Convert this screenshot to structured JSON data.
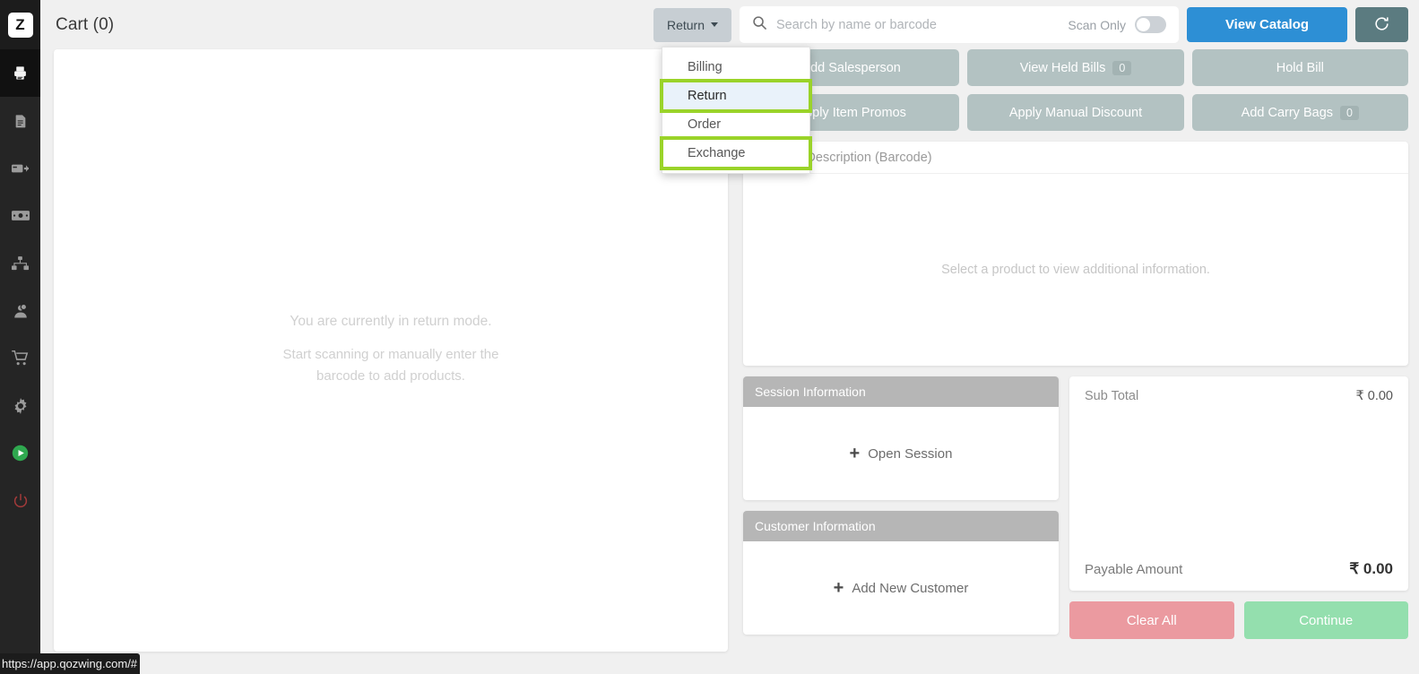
{
  "sidebar": {
    "logo_text": "Z",
    "items": [
      {
        "name": "receipt-printer",
        "label": "Billing",
        "active": true
      },
      {
        "name": "document",
        "label": "Documents",
        "active": false
      },
      {
        "name": "card-swipe",
        "label": "Payments",
        "active": false
      },
      {
        "name": "cash-note",
        "label": "Cash",
        "active": false
      },
      {
        "name": "org-chart",
        "label": "Hierarchy",
        "active": false
      },
      {
        "name": "user-profile",
        "label": "Customers",
        "active": false
      },
      {
        "name": "shopping-cart",
        "label": "Cart",
        "active": false
      },
      {
        "name": "gear",
        "label": "Settings",
        "active": false
      },
      {
        "name": "play-circle",
        "label": "Start",
        "active": false
      },
      {
        "name": "power",
        "label": "Logout",
        "active": false
      }
    ]
  },
  "header": {
    "cart_title": "Cart (0)",
    "mode_button": "Return",
    "search_placeholder": "Search by name or barcode",
    "search_value": "",
    "scan_only_label": "Scan Only",
    "scan_only_on": false,
    "view_catalog": "View Catalog",
    "refresh_icon": "refresh-icon"
  },
  "dropdown": {
    "open": true,
    "items": [
      {
        "label": "Billing",
        "selected": false,
        "highlighted": false
      },
      {
        "label": "Return",
        "selected": true,
        "highlighted": true
      },
      {
        "label": "Order",
        "selected": false,
        "highlighted": false
      },
      {
        "label": "Exchange",
        "selected": false,
        "highlighted": true
      }
    ]
  },
  "cart": {
    "empty_line1": "You are currently in return mode.",
    "empty_line2": "Start scanning or manually enter the barcode to add products."
  },
  "actions": [
    {
      "label": "Add Salesperson",
      "badge": null
    },
    {
      "label": "View Held Bills",
      "badge": "0"
    },
    {
      "label": "Hold Bill",
      "badge": null
    },
    {
      "label": "Apply Item Promos",
      "badge": null
    },
    {
      "label": "Apply Manual Discount",
      "badge": null
    },
    {
      "label": "Add Carry Bags",
      "badge": "0"
    }
  ],
  "product_panel": {
    "header": "Name & Description (Barcode)",
    "empty_text": "Select a product to view additional information."
  },
  "session": {
    "title": "Session Information",
    "action": "Open Session"
  },
  "customer": {
    "title": "Customer Information",
    "action": "Add New Customer"
  },
  "totals": {
    "sub_total_label": "Sub Total",
    "sub_total_value": "₹ 0.00",
    "payable_label": "Payable Amount",
    "payable_value": "₹ 0.00",
    "clear_all": "Clear All",
    "continue": "Continue"
  },
  "statusbar": {
    "url": "https://app.qozwing.com/#"
  },
  "colors": {
    "accent_blue": "#2d8fd5",
    "action_button": "#b3c2c2",
    "highlight_green": "#9ad329",
    "clear_red": "#eb9aa0",
    "continue_green": "#94dfae",
    "sidebar_dark": "#252525"
  }
}
